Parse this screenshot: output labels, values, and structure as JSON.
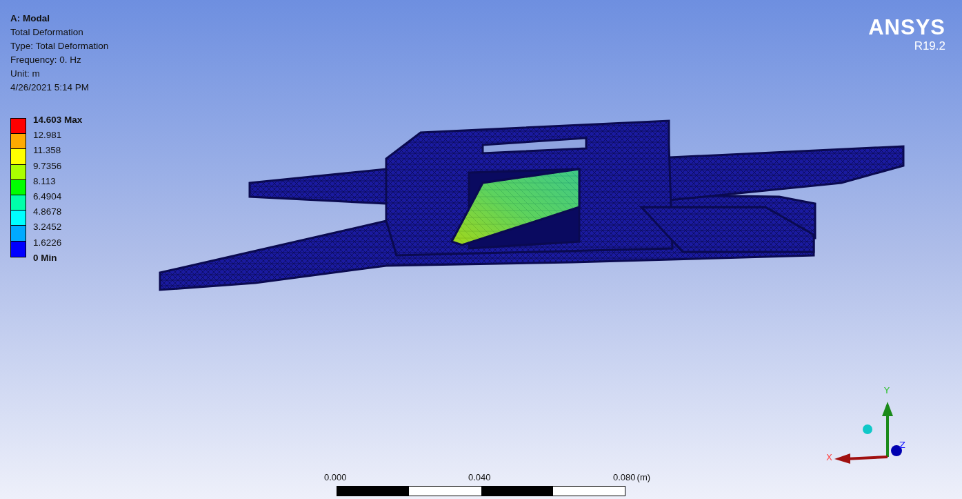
{
  "header": {
    "title": "A: Modal",
    "lines": [
      "Total Deformation",
      "Type: Total Deformation",
      "Frequency: 0. Hz",
      "Unit: m",
      "4/26/2021 5:14 PM"
    ]
  },
  "legend": {
    "labels": [
      {
        "text": "14.603 Max",
        "kind": "max"
      },
      {
        "text": "12.981",
        "kind": "value"
      },
      {
        "text": "11.358",
        "kind": "value"
      },
      {
        "text": "9.7356",
        "kind": "value"
      },
      {
        "text": "8.113",
        "kind": "value"
      },
      {
        "text": "6.4904",
        "kind": "value"
      },
      {
        "text": "4.8678",
        "kind": "value"
      },
      {
        "text": "3.2452",
        "kind": "value"
      },
      {
        "text": "1.6226",
        "kind": "value"
      },
      {
        "text": "0 Min",
        "kind": "min"
      }
    ],
    "bands": [
      {
        "color": "#ff0000"
      },
      {
        "color": "#ffaa00"
      },
      {
        "color": "#ffff00"
      },
      {
        "color": "#aaff00"
      },
      {
        "color": "#00ff00"
      },
      {
        "color": "#00ffaa"
      },
      {
        "color": "#00ffff"
      },
      {
        "color": "#00aaff"
      },
      {
        "color": "#0000ff"
      }
    ]
  },
  "logo": {
    "name": "ANSYS",
    "version": "R19.2"
  },
  "triad": {
    "x": "X",
    "y": "Y",
    "z": "Z"
  },
  "scale_bar": {
    "ticks": [
      "0.000",
      "0.040",
      "0.080"
    ],
    "unit": "(m)"
  }
}
